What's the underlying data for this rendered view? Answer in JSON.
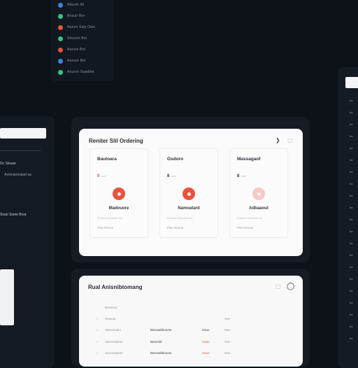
{
  "status_list": [
    {
      "label": "Aduuto Ilti",
      "color": "#3a86d8"
    },
    {
      "label": "Bnsuir Bor",
      "color": "#3fbf8a"
    },
    {
      "label": "Nanzo Saly Oelo",
      "color": "#e8533f"
    },
    {
      "label": "Smuren Bor",
      "color": "#3fbf8a"
    },
    {
      "label": "Aunsio Bol",
      "color": "#e8533f"
    },
    {
      "label": "Aunsre Bol",
      "color": "#3a86d8"
    },
    {
      "label": "Auuoro Suaditor",
      "color": "#3fbf8a"
    }
  ],
  "left_sidebar": {
    "input_value": "",
    "item1": "Dc Slouse",
    "item2": "Asmnanieatad aa",
    "item3": "Soao Soeie Brsa"
  },
  "pricing": {
    "title": "Reniter Slil Ordering",
    "plans": [
      {
        "name": "Bauloara",
        "price": "0",
        "price_suffix": "aure",
        "accent": "#e8533f",
        "button": "Madouore",
        "desc": "Enonus Deouiae tuu",
        "foot": "Pise Noooe"
      },
      {
        "name": "Gsdoro",
        "price": "8",
        "price_suffix": "aure",
        "accent": "#e8533f",
        "button": "Namoatard",
        "desc": "Enoane Deouiae tuu",
        "foot": "Pise Noooe"
      },
      {
        "name": "Massagaof",
        "price": "8",
        "price_suffix": "aure",
        "accent": "#f7c8c4",
        "button": "Adbaaout",
        "desc": "Enoane Deouiae tuu",
        "foot": "Pise Noooe"
      }
    ]
  },
  "table": {
    "title": "Rual Anisnibtomang",
    "header": "Bossnuo",
    "rows": [
      {
        "c1": "Soueuu",
        "c2": "",
        "c3": "",
        "c4": "Soe",
        "red": false
      },
      {
        "c1": "Sarousaarc",
        "c2": "Banuaddeoune",
        "c3": "Souo",
        "c4": "Sau",
        "red": false
      },
      {
        "c1": "Saronoaaner",
        "c2": "Bannold",
        "c3": "Soao",
        "c4": "Soe",
        "red": true
      },
      {
        "c1": "Saronoaaner",
        "c2": "Banuaddeoune",
        "c3": "Souo",
        "c4": "Soe",
        "red": true
      }
    ]
  },
  "right_panel": {
    "labels": [
      "ba",
      "ba",
      "ba",
      "ba",
      "ba",
      "ba",
      "ba",
      "ba",
      "ba",
      "ba",
      "ba",
      "ba",
      "ba",
      "ba",
      "ba",
      "ba",
      "ba",
      "ba",
      "ba",
      "ba",
      "ba"
    ]
  }
}
